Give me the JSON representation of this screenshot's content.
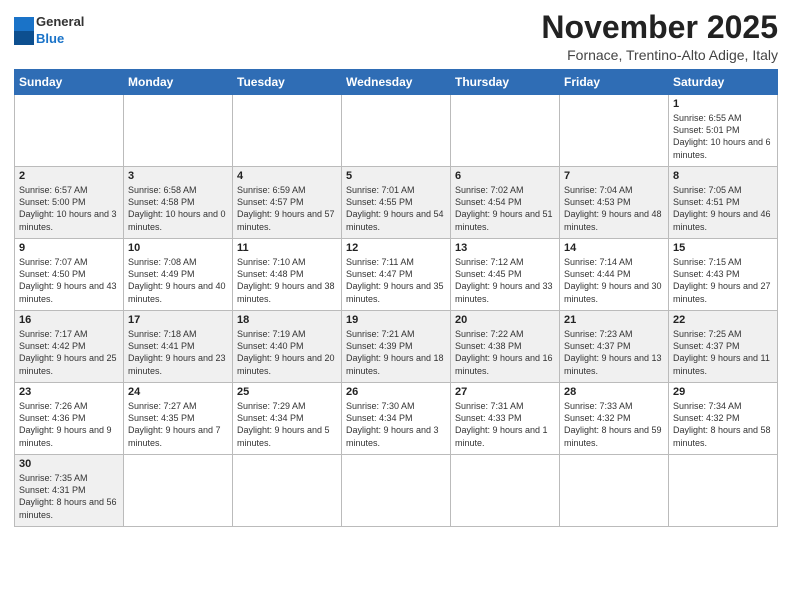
{
  "header": {
    "logo_general": "General",
    "logo_blue": "Blue",
    "month_title": "November 2025",
    "location": "Fornace, Trentino-Alto Adige, Italy"
  },
  "days_of_week": [
    "Sunday",
    "Monday",
    "Tuesday",
    "Wednesday",
    "Thursday",
    "Friday",
    "Saturday"
  ],
  "weeks": [
    [
      {
        "day": "",
        "info": ""
      },
      {
        "day": "",
        "info": ""
      },
      {
        "day": "",
        "info": ""
      },
      {
        "day": "",
        "info": ""
      },
      {
        "day": "",
        "info": ""
      },
      {
        "day": "",
        "info": ""
      },
      {
        "day": "1",
        "info": "Sunrise: 6:55 AM\nSunset: 5:01 PM\nDaylight: 10 hours\nand 6 minutes."
      }
    ],
    [
      {
        "day": "2",
        "info": "Sunrise: 6:57 AM\nSunset: 5:00 PM\nDaylight: 10 hours\nand 3 minutes."
      },
      {
        "day": "3",
        "info": "Sunrise: 6:58 AM\nSunset: 4:58 PM\nDaylight: 10 hours\nand 0 minutes."
      },
      {
        "day": "4",
        "info": "Sunrise: 6:59 AM\nSunset: 4:57 PM\nDaylight: 9 hours\nand 57 minutes."
      },
      {
        "day": "5",
        "info": "Sunrise: 7:01 AM\nSunset: 4:55 PM\nDaylight: 9 hours\nand 54 minutes."
      },
      {
        "day": "6",
        "info": "Sunrise: 7:02 AM\nSunset: 4:54 PM\nDaylight: 9 hours\nand 51 minutes."
      },
      {
        "day": "7",
        "info": "Sunrise: 7:04 AM\nSunset: 4:53 PM\nDaylight: 9 hours\nand 48 minutes."
      },
      {
        "day": "8",
        "info": "Sunrise: 7:05 AM\nSunset: 4:51 PM\nDaylight: 9 hours\nand 46 minutes."
      }
    ],
    [
      {
        "day": "9",
        "info": "Sunrise: 7:07 AM\nSunset: 4:50 PM\nDaylight: 9 hours\nand 43 minutes."
      },
      {
        "day": "10",
        "info": "Sunrise: 7:08 AM\nSunset: 4:49 PM\nDaylight: 9 hours\nand 40 minutes."
      },
      {
        "day": "11",
        "info": "Sunrise: 7:10 AM\nSunset: 4:48 PM\nDaylight: 9 hours\nand 38 minutes."
      },
      {
        "day": "12",
        "info": "Sunrise: 7:11 AM\nSunset: 4:47 PM\nDaylight: 9 hours\nand 35 minutes."
      },
      {
        "day": "13",
        "info": "Sunrise: 7:12 AM\nSunset: 4:45 PM\nDaylight: 9 hours\nand 33 minutes."
      },
      {
        "day": "14",
        "info": "Sunrise: 7:14 AM\nSunset: 4:44 PM\nDaylight: 9 hours\nand 30 minutes."
      },
      {
        "day": "15",
        "info": "Sunrise: 7:15 AM\nSunset: 4:43 PM\nDaylight: 9 hours\nand 27 minutes."
      }
    ],
    [
      {
        "day": "16",
        "info": "Sunrise: 7:17 AM\nSunset: 4:42 PM\nDaylight: 9 hours\nand 25 minutes."
      },
      {
        "day": "17",
        "info": "Sunrise: 7:18 AM\nSunset: 4:41 PM\nDaylight: 9 hours\nand 23 minutes."
      },
      {
        "day": "18",
        "info": "Sunrise: 7:19 AM\nSunset: 4:40 PM\nDaylight: 9 hours\nand 20 minutes."
      },
      {
        "day": "19",
        "info": "Sunrise: 7:21 AM\nSunset: 4:39 PM\nDaylight: 9 hours\nand 18 minutes."
      },
      {
        "day": "20",
        "info": "Sunrise: 7:22 AM\nSunset: 4:38 PM\nDaylight: 9 hours\nand 16 minutes."
      },
      {
        "day": "21",
        "info": "Sunrise: 7:23 AM\nSunset: 4:37 PM\nDaylight: 9 hours\nand 13 minutes."
      },
      {
        "day": "22",
        "info": "Sunrise: 7:25 AM\nSunset: 4:37 PM\nDaylight: 9 hours\nand 11 minutes."
      }
    ],
    [
      {
        "day": "23",
        "info": "Sunrise: 7:26 AM\nSunset: 4:36 PM\nDaylight: 9 hours\nand 9 minutes."
      },
      {
        "day": "24",
        "info": "Sunrise: 7:27 AM\nSunset: 4:35 PM\nDaylight: 9 hours\nand 7 minutes."
      },
      {
        "day": "25",
        "info": "Sunrise: 7:29 AM\nSunset: 4:34 PM\nDaylight: 9 hours\nand 5 minutes."
      },
      {
        "day": "26",
        "info": "Sunrise: 7:30 AM\nSunset: 4:34 PM\nDaylight: 9 hours\nand 3 minutes."
      },
      {
        "day": "27",
        "info": "Sunrise: 7:31 AM\nSunset: 4:33 PM\nDaylight: 9 hours\nand 1 minute."
      },
      {
        "day": "28",
        "info": "Sunrise: 7:33 AM\nSunset: 4:32 PM\nDaylight: 8 hours\nand 59 minutes."
      },
      {
        "day": "29",
        "info": "Sunrise: 7:34 AM\nSunset: 4:32 PM\nDaylight: 8 hours\nand 58 minutes."
      }
    ],
    [
      {
        "day": "30",
        "info": "Sunrise: 7:35 AM\nSunset: 4:31 PM\nDaylight: 8 hours\nand 56 minutes."
      },
      {
        "day": "",
        "info": ""
      },
      {
        "day": "",
        "info": ""
      },
      {
        "day": "",
        "info": ""
      },
      {
        "day": "",
        "info": ""
      },
      {
        "day": "",
        "info": ""
      },
      {
        "day": "",
        "info": ""
      }
    ]
  ]
}
